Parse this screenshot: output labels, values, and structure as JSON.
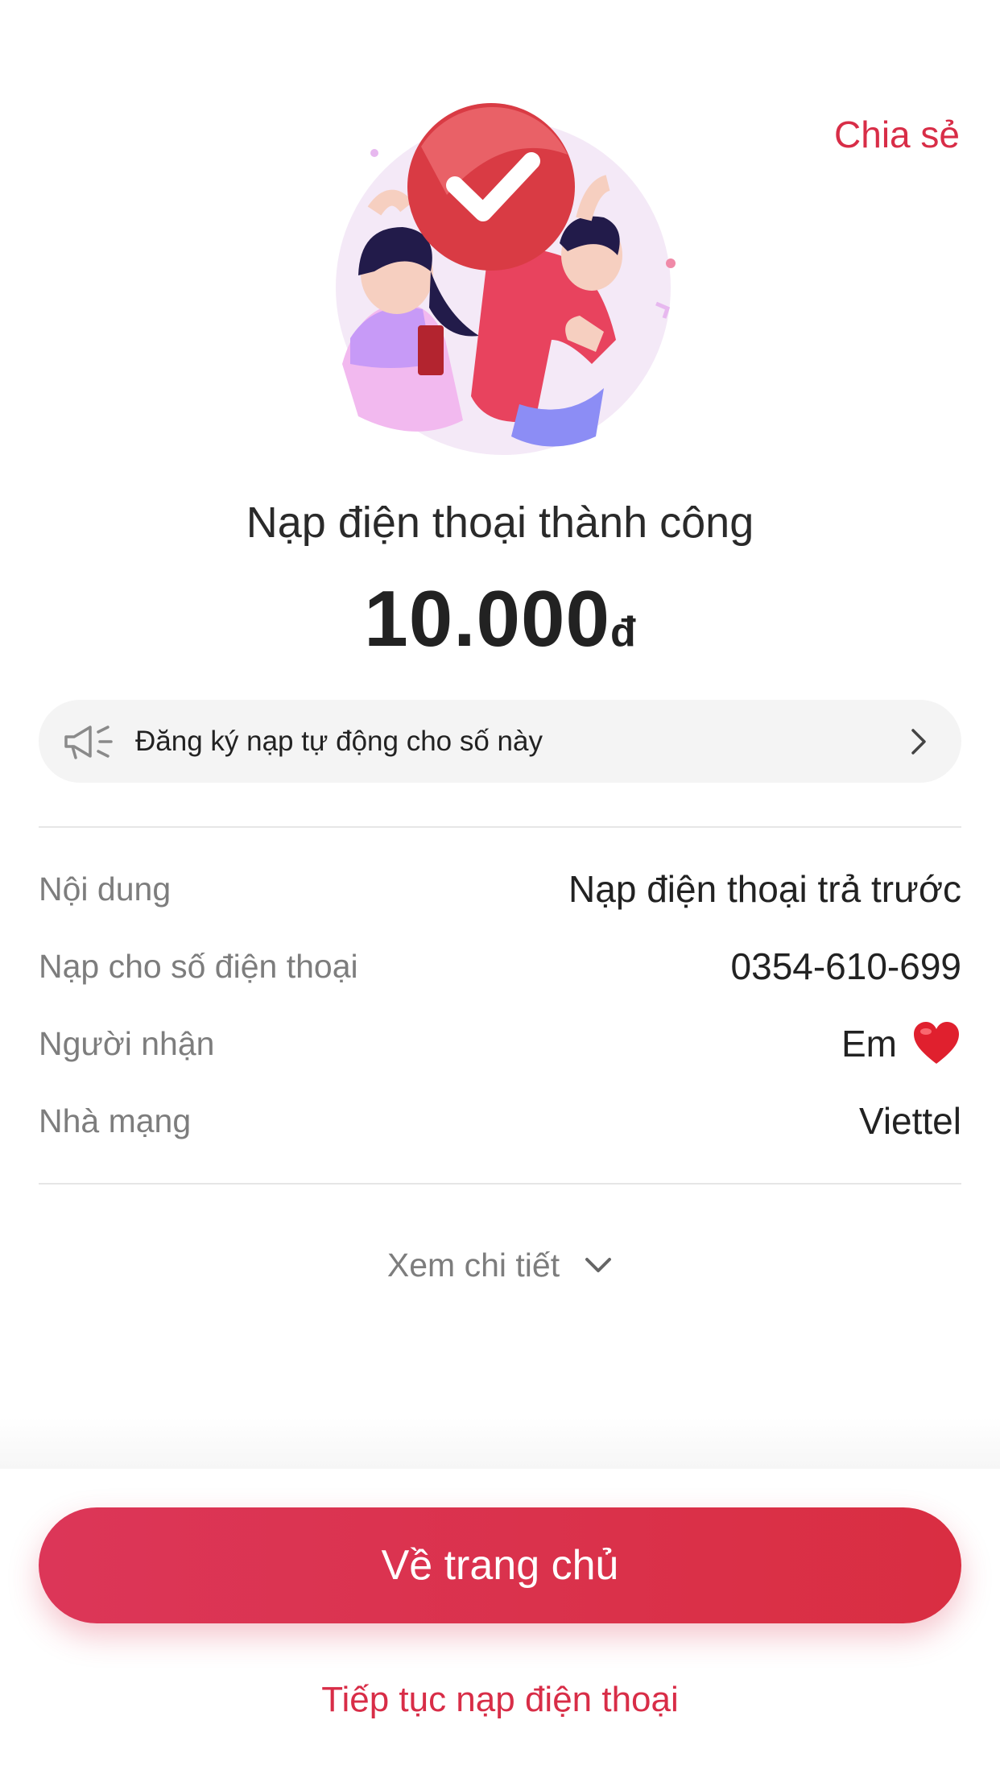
{
  "header": {
    "share_label": "Chia sẻ"
  },
  "result": {
    "title": "Nạp điện thoại thành công",
    "amount": "10.000",
    "currency": "đ"
  },
  "promo": {
    "text": "Đăng ký nạp tự động cho số này",
    "icon": "megaphone-icon"
  },
  "details": [
    {
      "label": "Nội dung",
      "value": "Nạp điện thoại trả trước"
    },
    {
      "label": "Nạp cho số điện thoại",
      "value": "0354-610-699"
    },
    {
      "label": "Người nhận",
      "value": "Em",
      "emoji": "heart-icon"
    },
    {
      "label": "Nhà mạng",
      "value": "Viettel"
    }
  ],
  "see_more": {
    "label": "Xem chi tiết"
  },
  "actions": {
    "home_label": "Về trang chủ",
    "continue_label": "Tiếp tục nạp điện thoại"
  },
  "colors": {
    "brand": "#d82d47",
    "button_start": "#dc3658",
    "button_end": "#d92e42"
  }
}
